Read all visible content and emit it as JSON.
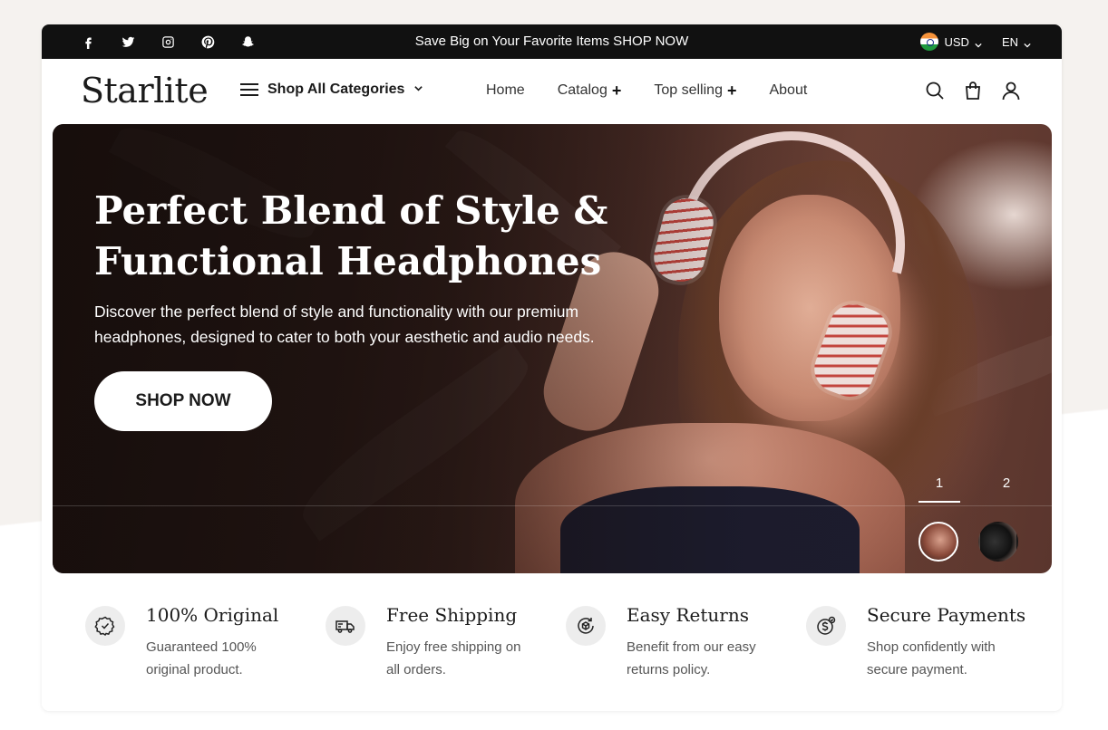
{
  "topbar": {
    "socials": [
      "facebook",
      "twitter",
      "instagram",
      "pinterest",
      "snapchat"
    ],
    "promo": "Save Big on Your Favorite Items SHOP NOW",
    "currency": "USD",
    "language": "EN"
  },
  "header": {
    "logo": "Starlite",
    "categories_label": "Shop All Categories",
    "nav": [
      {
        "label": "Home"
      },
      {
        "label": "Catalog",
        "plus": "+"
      },
      {
        "label": "Top selling",
        "plus": "+"
      },
      {
        "label": "About"
      }
    ]
  },
  "hero": {
    "title_line1": "Perfect Blend of Style &",
    "title_line2": "Functional Headphones",
    "subtitle_line1": "Discover the perfect blend of style and functionality with our premium",
    "subtitle_line2": "headphones, designed to cater to both your aesthetic and audio needs.",
    "cta": "SHOP NOW",
    "slides": [
      "1",
      "2"
    ]
  },
  "features": [
    {
      "title": "100% Original",
      "desc": "Guaranteed 100% original product."
    },
    {
      "title": "Free Shipping",
      "desc": "Enjoy free shipping on all orders."
    },
    {
      "title": "Easy Returns",
      "desc": "Benefit from our easy returns policy."
    },
    {
      "title": "Secure Payments",
      "desc": "Shop confidently with secure payment."
    }
  ]
}
